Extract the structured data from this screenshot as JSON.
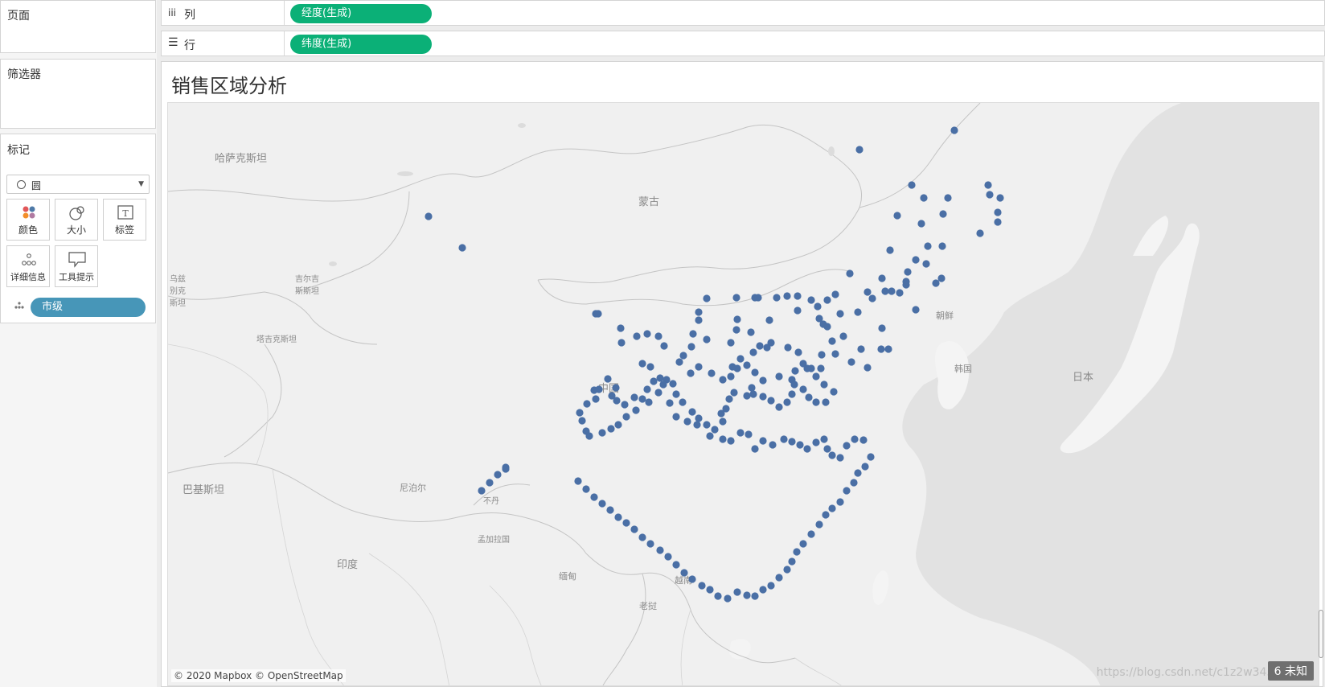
{
  "left_panel": {
    "pages_title": "页面",
    "filters_title": "筛选器",
    "marks_title": "标记",
    "mark_type": "圆",
    "tiles": [
      {
        "label": "颜色",
        "icon": "color-icon"
      },
      {
        "label": "大小",
        "icon": "size-icon"
      },
      {
        "label": "标签",
        "icon": "label-icon"
      },
      {
        "label": "详细信息",
        "icon": "detail-icon"
      },
      {
        "label": "工具提示",
        "icon": "tooltip-icon"
      }
    ],
    "detail_pill": "市级"
  },
  "shelves": {
    "columns_label": "列",
    "columns_pill": "经度(生成)",
    "rows_label": "行",
    "rows_pill": "纬度(生成)"
  },
  "view": {
    "title": "销售区域分析",
    "map_labels": [
      "哈萨克斯坦",
      "蒙古",
      "中国",
      "日本",
      "印度",
      "巴基斯坦",
      "朝鲜",
      "韩国",
      "尼泊尔",
      "吉尔吉斯斯坦",
      "塔吉克斯坦",
      "老挝",
      "缅甸",
      "孟加拉国",
      "不丹",
      "越南",
      "乌兹别克斯坦"
    ],
    "attribution": "© 2020 Mapbox © OpenStreetMap",
    "unknown_badge": "6 未知",
    "watermark": "https://blog.csdn.net/c1z2w3456789"
  },
  "colors": {
    "shelf_pill": "#0bb077",
    "detail_pill": "#4796b8",
    "mark": "#4a6fa5",
    "land": "#f2f2f2",
    "sea": "#e3e3e3"
  }
}
